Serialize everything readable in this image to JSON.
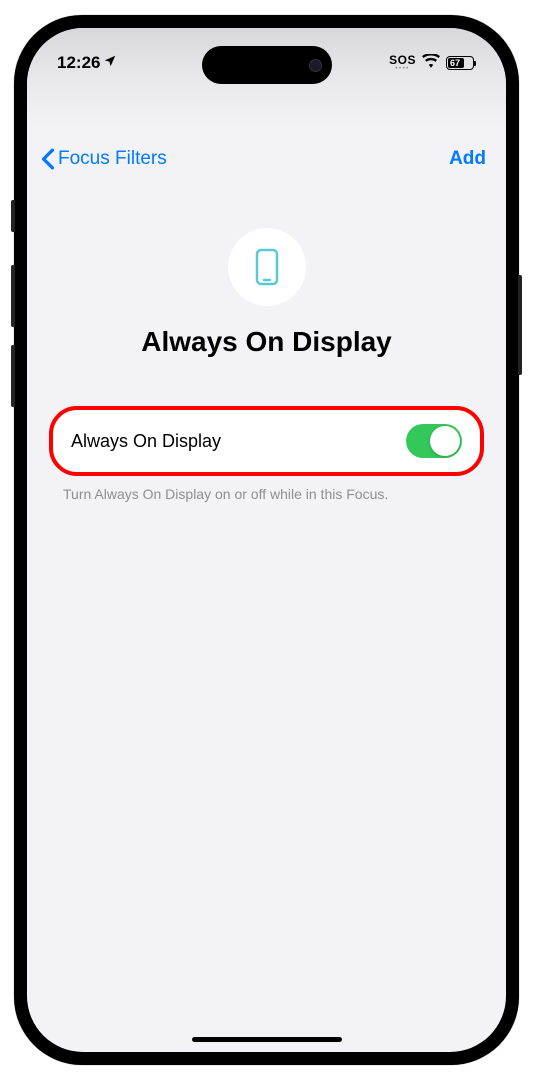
{
  "status_bar": {
    "time": "12:26",
    "sos": "SOS",
    "battery_pct": "67"
  },
  "nav": {
    "back_label": "Focus Filters",
    "add_label": "Add"
  },
  "header": {
    "title": "Always On Display"
  },
  "setting": {
    "label": "Always On Display",
    "enabled": true,
    "description": "Turn Always On Display on or off while in this Focus."
  }
}
